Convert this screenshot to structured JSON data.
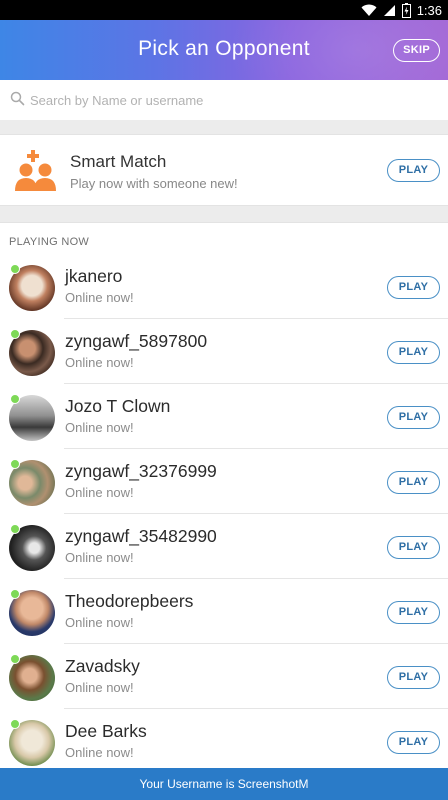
{
  "status_bar": {
    "time": "1:36"
  },
  "header": {
    "title": "Pick an Opponent",
    "skip_label": "SKIP"
  },
  "search": {
    "placeholder": "Search by Name or username"
  },
  "smart_match": {
    "title": "Smart Match",
    "subtitle": "Play now with someone new!",
    "play_label": "PLAY",
    "icon": "add-friends-icon"
  },
  "playing_now": {
    "label": "PLAYING NOW",
    "players": [
      {
        "name": "jkanero",
        "status": "Online now!",
        "play_label": "PLAY"
      },
      {
        "name": "zyngawf_5897800",
        "status": "Online now!",
        "play_label": "PLAY"
      },
      {
        "name": "Jozo T Clown",
        "status": "Online now!",
        "play_label": "PLAY"
      },
      {
        "name": "zyngawf_32376999",
        "status": "Online now!",
        "play_label": "PLAY"
      },
      {
        "name": "zyngawf_35482990",
        "status": "Online now!",
        "play_label": "PLAY"
      },
      {
        "name": "Theodorepbeers",
        "status": "Online now!",
        "play_label": "PLAY"
      },
      {
        "name": "Zavadsky",
        "status": "Online now!",
        "play_label": "PLAY"
      },
      {
        "name": "Dee Barks",
        "status": "Online now!",
        "play_label": "PLAY"
      }
    ]
  },
  "footer": {
    "text": "Your Username is ScreenshotM"
  },
  "colors": {
    "header_start": "#3e86e6",
    "header_end": "#a266d6",
    "accent": "#2a7bc8",
    "smart_icon": "#f58a3c",
    "online": "#7ed957"
  }
}
